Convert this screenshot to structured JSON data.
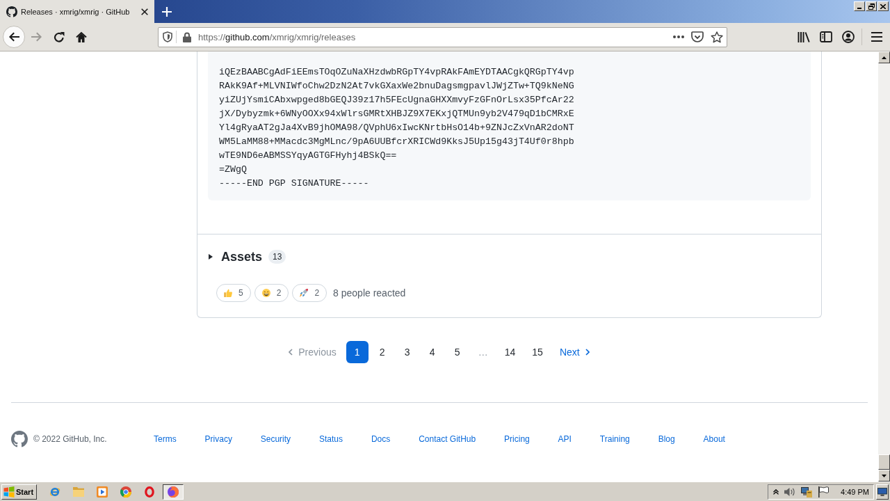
{
  "browser": {
    "tab": {
      "title": "Releases · xmrig/xmrig · GitHub"
    },
    "forward": {
      "disabled": true
    },
    "url": {
      "scheme": "https://",
      "host": "github.com",
      "path": "/xmrig/xmrig/releases"
    }
  },
  "release": {
    "signature_lines": [
      "iQEzBAABCgAdFiEEmsTOqOZuNaXHzdwbRGpTY4vpRAkFAmEYDTAACgkQRGpTY4vp",
      "RAkK9Af+MLVNIWfoChw2DzN2At7vkGXaxWe2bnuDagsmgpavlJWjZTw+TQ9kNeNG",
      "yiZUjYsmiCAbxwpged8bGEQJ39z17h5FEcUgnaGHXXmvyFzGFnOrLsx35PfcAr22",
      "jX/Dybyzmk+6WNyOOXx94xWlrsGMRtXHBJZ9X7EKxjQTMUn9yb2V479qD1bCMRxE",
      "Yl4gRyaAT2gJa4XvB9jhOMA98/QVphU6xIwcKNrtbHsO14b+9ZNJcZxVnAR2doNT",
      "WM5LaMM88+MMacdc3MgMLnc/9pA6UUBfcrXRICWd9KksJ5Up15g43jT4Uf0r8hpb",
      "wTE9ND6eABMSSYqyAGTGFHyhj4BSkQ==",
      "=ZWgQ",
      "-----END PGP SIGNATURE-----"
    ],
    "assets": {
      "label": "Assets",
      "count": "13",
      "expanded": false
    },
    "reactions": [
      {
        "kind": "thumbs-up",
        "count": "5"
      },
      {
        "kind": "laugh",
        "count": "2"
      },
      {
        "kind": "rocket",
        "count": "2"
      }
    ],
    "reaction_summary": "8 people reacted"
  },
  "pagination": {
    "previous": {
      "label": "Previous",
      "disabled": true
    },
    "pages": [
      {
        "kind": "page",
        "label": "1",
        "selected": true
      },
      {
        "kind": "page",
        "label": "2",
        "selected": false
      },
      {
        "kind": "page",
        "label": "3",
        "selected": false
      },
      {
        "kind": "page",
        "label": "4",
        "selected": false
      },
      {
        "kind": "page",
        "label": "5",
        "selected": false
      },
      {
        "kind": "gap",
        "label": "…",
        "selected": false
      },
      {
        "kind": "page",
        "label": "14",
        "selected": false
      },
      {
        "kind": "page",
        "label": "15",
        "selected": false
      }
    ],
    "next": {
      "label": "Next",
      "disabled": false
    }
  },
  "footer": {
    "copyright": "© 2022 GitHub, Inc.",
    "links": [
      "Terms",
      "Privacy",
      "Security",
      "Status",
      "Docs",
      "Contact GitHub",
      "Pricing",
      "API",
      "Training",
      "Blog",
      "About"
    ]
  },
  "taskbar": {
    "start": "Start",
    "apps": [
      {
        "kind": "ie",
        "selected": false
      },
      {
        "kind": "explorer",
        "selected": false
      },
      {
        "kind": "media",
        "selected": false
      },
      {
        "kind": "chrome",
        "selected": false
      },
      {
        "kind": "opera",
        "selected": false
      },
      {
        "kind": "firefox",
        "selected": true
      }
    ],
    "clock": "4:49 PM"
  }
}
